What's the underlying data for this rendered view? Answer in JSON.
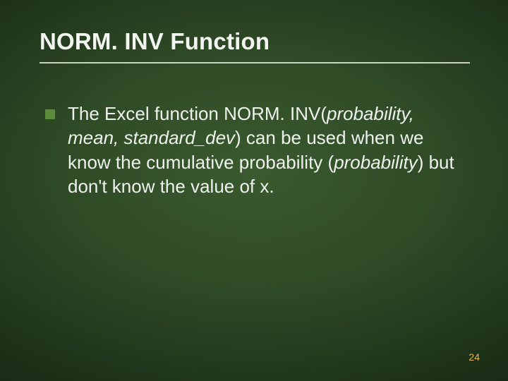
{
  "slide": {
    "title": "NORM. INV Function",
    "bullet": {
      "seg1": "The Excel function NORM. INV(",
      "arg1": "probability, mean, standard_dev",
      "seg2": ") can be used when we know the cumulative probability (",
      "arg2": "probability",
      "seg3": ") but don't know the value of x."
    },
    "page_number": "24"
  }
}
